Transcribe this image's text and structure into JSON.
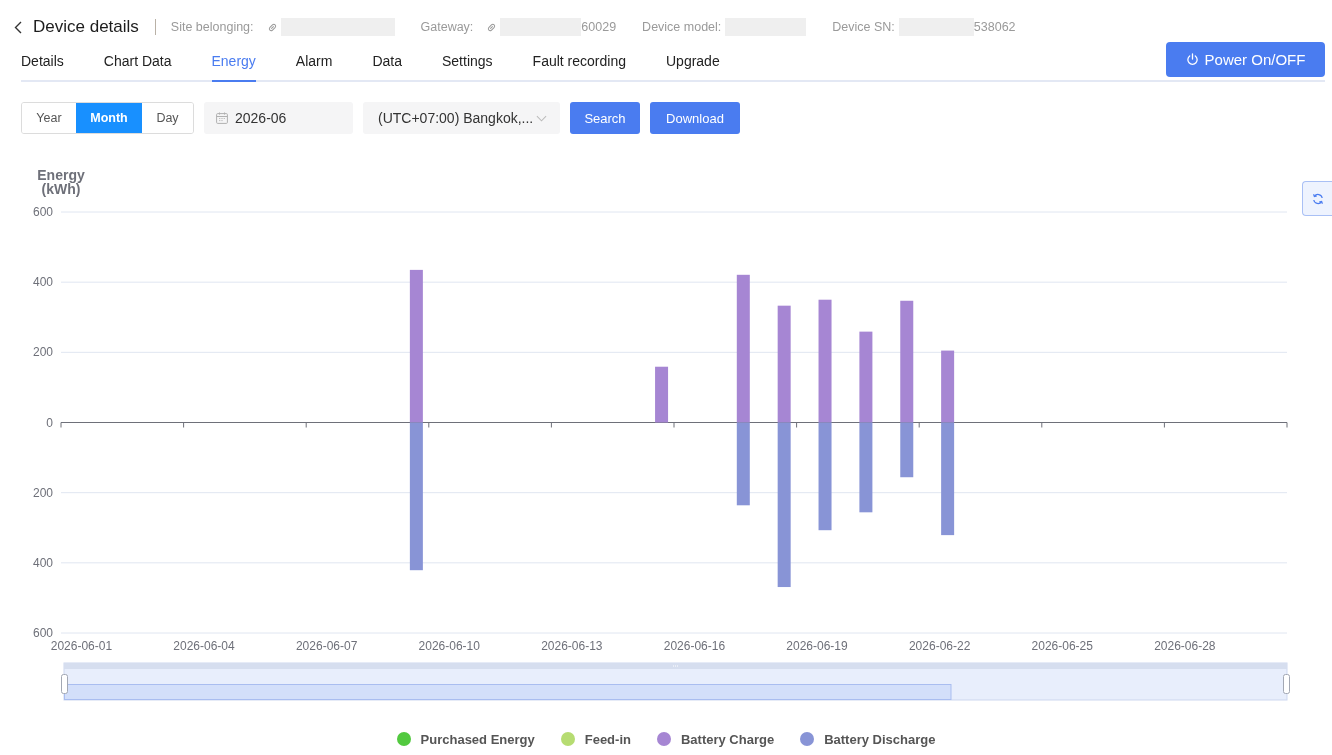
{
  "header": {
    "title": "Device details",
    "fields": [
      {
        "label": "Site belonging:",
        "link": true,
        "redacted": true
      },
      {
        "label": "Gateway:",
        "link": true,
        "redacted": true,
        "value": "60029"
      },
      {
        "label": "Device model:",
        "link": false,
        "redacted": true
      },
      {
        "label": "Device SN:",
        "link": false,
        "redacted": true,
        "value": "538062"
      }
    ]
  },
  "tabs": [
    {
      "label": "Details",
      "selected": false
    },
    {
      "label": "Chart Data",
      "selected": false
    },
    {
      "label": "Energy",
      "selected": true
    },
    {
      "label": "Alarm",
      "selected": false
    },
    {
      "label": "Data",
      "selected": false
    },
    {
      "label": "Settings",
      "selected": false
    },
    {
      "label": "Fault recording",
      "selected": false
    },
    {
      "label": "Upgrade",
      "selected": false
    }
  ],
  "power_button": {
    "label": "Power On/OFF"
  },
  "filters": {
    "period_tabs": [
      {
        "label": "Year",
        "selected": false
      },
      {
        "label": "Month",
        "selected": true
      },
      {
        "label": "Day",
        "selected": false
      }
    ],
    "date_field": {
      "value": "2026-06"
    },
    "timezone_select": {
      "value": "(UTC+07:00) Bangkok,..."
    },
    "buttons": [
      "Search",
      "Download"
    ]
  },
  "chart": {
    "chart_data": {
      "type": "bar",
      "ylabel": "Energy (kWh)",
      "categories": [
        "2026-06-01",
        null,
        null,
        "2026-06-04",
        null,
        null,
        "2026-06-07",
        null,
        null,
        "2026-06-10",
        null,
        null,
        "2026-06-13",
        null,
        null,
        "2026-06-16",
        null,
        null,
        "2026-06-19",
        null,
        null,
        "2026-06-22",
        null,
        null,
        "2026-06-25",
        null,
        null,
        "2026-06-28",
        null,
        null
      ],
      "series": [
        {
          "name": "Purchased Energy",
          "color": "#52c93f",
          "values": [
            0,
            0,
            0,
            0,
            0,
            0,
            0,
            0,
            0,
            0,
            0,
            0,
            0,
            0,
            0,
            0,
            0,
            0,
            0,
            0,
            0,
            0,
            0,
            0,
            0,
            0,
            0,
            0,
            0,
            0
          ]
        },
        {
          "name": "Feed-in",
          "color": "#b6dc72",
          "values": [
            0,
            0,
            0,
            0,
            0,
            0,
            0,
            0,
            0,
            0,
            0,
            0,
            0,
            0,
            0,
            0,
            0,
            0,
            0,
            0,
            0,
            0,
            0,
            0,
            0,
            0,
            0,
            0,
            0,
            0
          ]
        },
        {
          "name": "Battery Charge",
          "color": "#a686d3",
          "values": [
            0,
            0,
            0,
            0,
            0,
            0,
            0,
            0,
            435,
            0,
            0,
            0,
            0,
            0,
            159,
            0,
            421,
            333,
            350,
            259,
            347,
            205,
            0,
            0,
            0,
            0,
            0,
            0,
            0,
            0
          ]
        },
        {
          "name": "Battery Discharge",
          "color": "#8894d6",
          "values": [
            0,
            0,
            0,
            0,
            0,
            0,
            0,
            0,
            -421,
            0,
            0,
            0,
            0,
            0,
            0,
            0,
            -236,
            -469,
            -307,
            -256,
            -156,
            -321,
            0,
            0,
            0,
            0,
            0,
            0,
            0,
            0
          ]
        }
      ],
      "ylim": [
        -600,
        600
      ],
      "yticks": [
        {
          "value": 600,
          "label": "600"
        },
        {
          "value": 400,
          "label": "400"
        },
        {
          "value": 200,
          "label": "200"
        },
        {
          "value": 0,
          "label": "0"
        },
        {
          "value": -200,
          "label": "200"
        },
        {
          "value": -400,
          "label": "400"
        },
        {
          "value": -600,
          "label": "600"
        }
      ],
      "grid": true,
      "stacked": false
    }
  }
}
